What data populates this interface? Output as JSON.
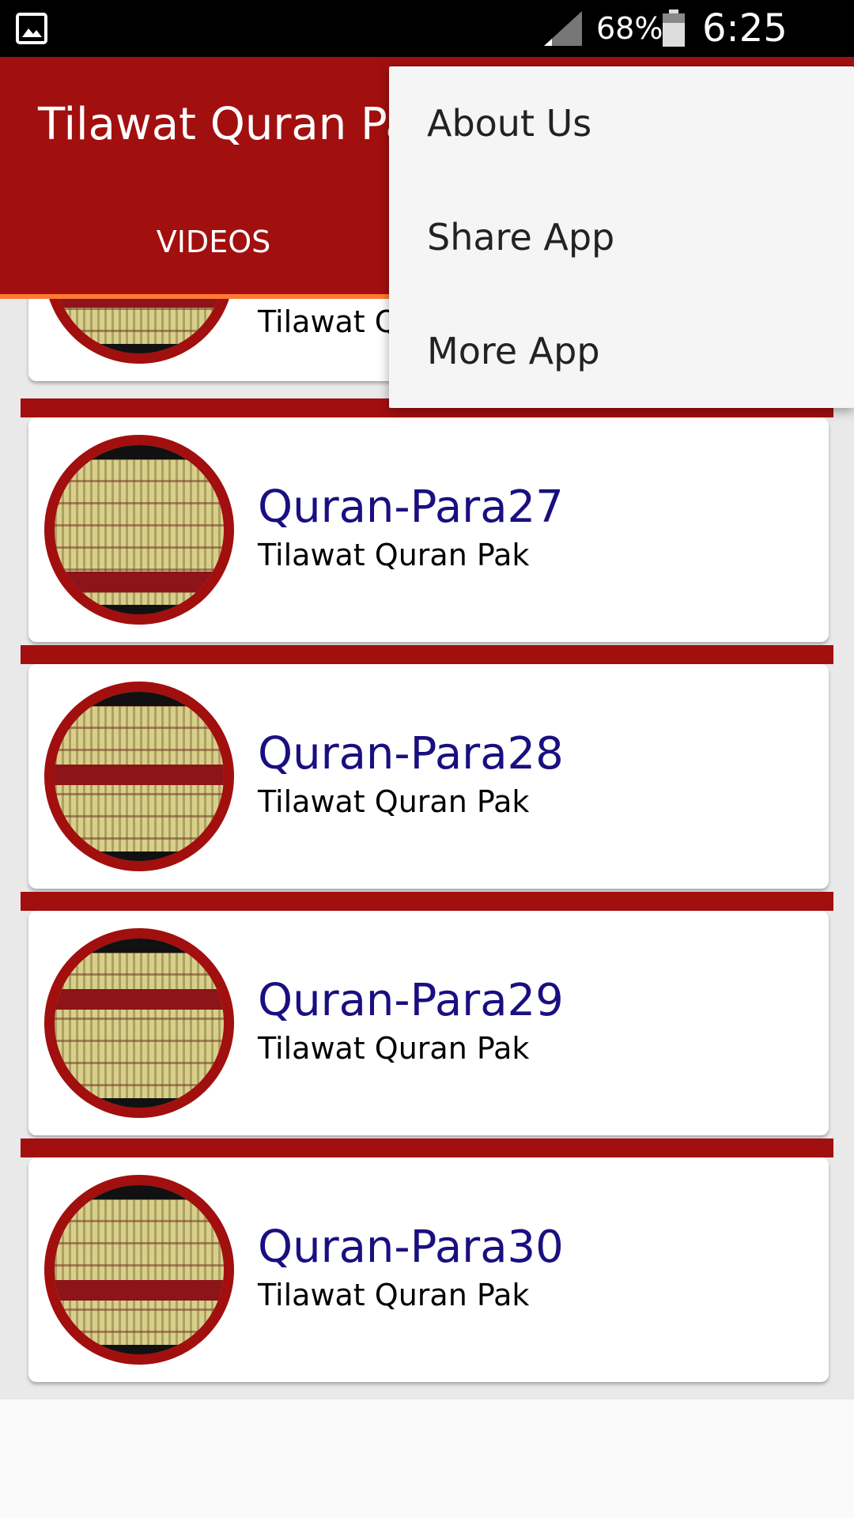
{
  "status_bar": {
    "battery_percent": "68%",
    "time": "6:25 PM",
    "icons": [
      "gallery-icon",
      "signal-icon",
      "battery-icon"
    ]
  },
  "app_bar": {
    "title": "Tilawat Quran Pa",
    "tabs": [
      {
        "label": "VIDEOS",
        "selected": true
      }
    ]
  },
  "colors": {
    "primary": "#a20f0f",
    "tab_indicator": "#ff7a33",
    "item_title": "#1a0f80"
  },
  "list": {
    "partial_item": {
      "subtitle": "Tilawat Q"
    },
    "items": [
      {
        "title": "Quran-Para27",
        "subtitle": "Tilawat Quran Pak"
      },
      {
        "title": "Quran-Para28",
        "subtitle": "Tilawat Quran Pak"
      },
      {
        "title": "Quran-Para29",
        "subtitle": "Tilawat Quran Pak"
      },
      {
        "title": "Quran-Para30",
        "subtitle": "Tilawat Quran Pak"
      }
    ]
  },
  "overflow_menu": {
    "items": [
      {
        "label": "About Us"
      },
      {
        "label": "Share App"
      },
      {
        "label": "More App"
      }
    ]
  }
}
